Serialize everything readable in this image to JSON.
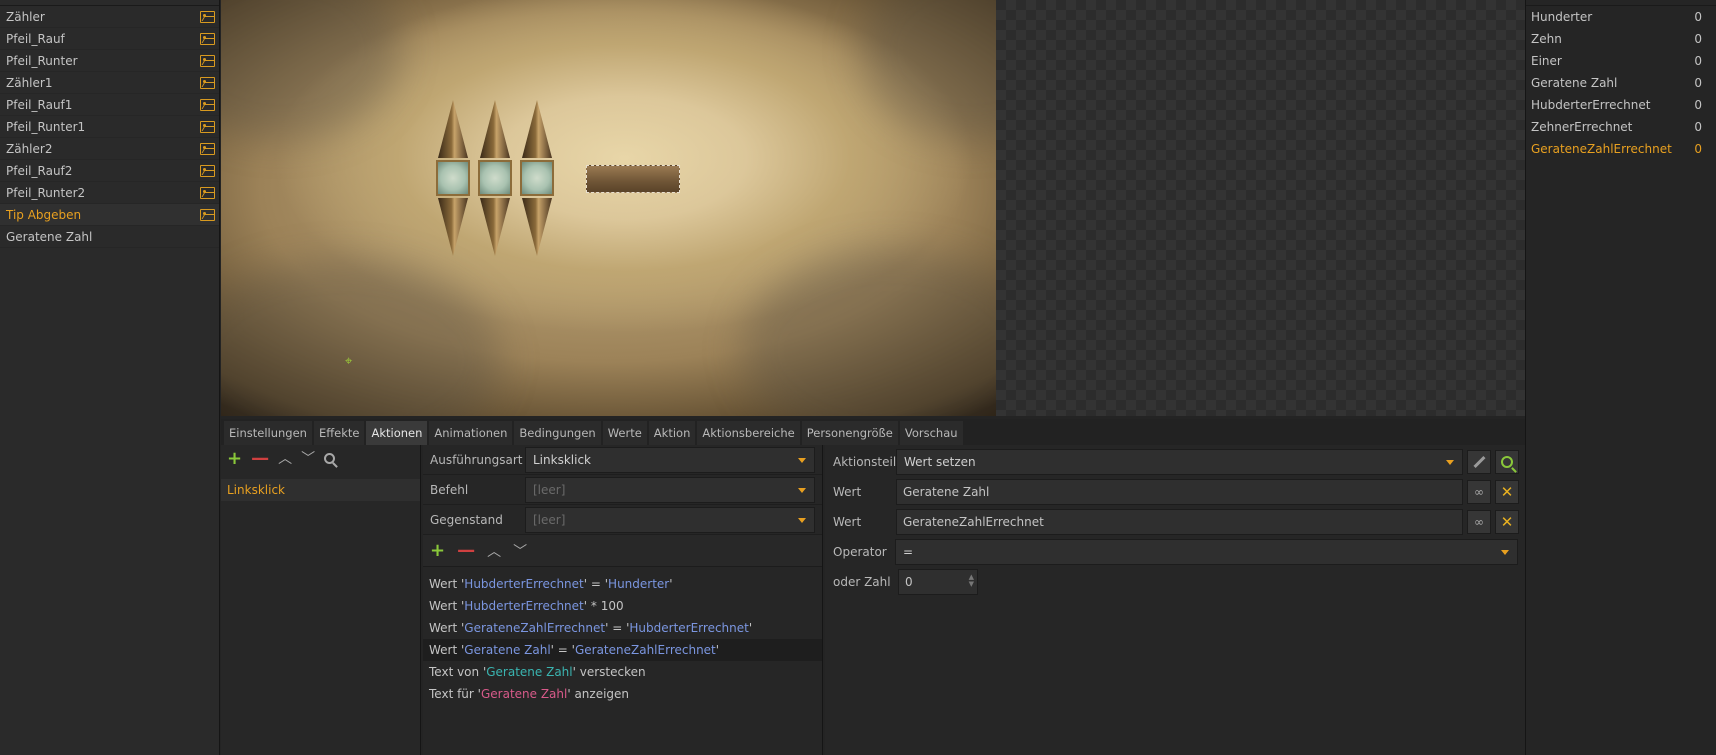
{
  "objects": [
    {
      "label": "Zähler",
      "has_image": true
    },
    {
      "label": "Pfeil_Rauf",
      "has_image": true
    },
    {
      "label": "Pfeil_Runter",
      "has_image": true
    },
    {
      "label": "Zähler1",
      "has_image": true
    },
    {
      "label": "Pfeil_Rauf1",
      "has_image": true
    },
    {
      "label": "Pfeil_Runter1",
      "has_image": true
    },
    {
      "label": "Zähler2",
      "has_image": true
    },
    {
      "label": "Pfeil_Rauf2",
      "has_image": true
    },
    {
      "label": "Pfeil_Runter2",
      "has_image": true
    },
    {
      "label": "Tip Abgeben",
      "has_image": true,
      "selected": true
    },
    {
      "label": "Geratene Zahl",
      "has_image": false
    }
  ],
  "variables": [
    {
      "name": "Hunderter",
      "value": "0"
    },
    {
      "name": "Zehn",
      "value": "0"
    },
    {
      "name": "Einer",
      "value": "0"
    },
    {
      "name": "Geratene Zahl",
      "value": "0"
    },
    {
      "name": "HubderterErrechnet",
      "value": "0"
    },
    {
      "name": "ZehnerErrechnet",
      "value": "0"
    },
    {
      "name": "GerateneZahlErrechnet",
      "value": "0",
      "highlight": true
    }
  ],
  "tabs": [
    "Einstellungen",
    "Effekte",
    "Aktionen",
    "Animationen",
    "Bedingungen",
    "Werte",
    "Aktion",
    "Aktionsbereiche",
    "Personengröße",
    "Vorschau"
  ],
  "active_tab": "Aktionen",
  "triggers": [
    "Linksklick"
  ],
  "form": {
    "exec_label": "Ausführungsart",
    "exec_value": "Linksklick",
    "cmd_label": "Befehl",
    "cmd_value": "[leer]",
    "item_label": "Gegenstand",
    "item_value": "[leer]"
  },
  "actions": [
    {
      "parts": [
        {
          "t": "Wert '",
          "c": ""
        },
        {
          "t": "HubderterErrechnet",
          "c": "blue"
        },
        {
          "t": "' = '",
          "c": ""
        },
        {
          "t": "Hunderter",
          "c": "blue"
        },
        {
          "t": "'",
          "c": ""
        }
      ]
    },
    {
      "parts": [
        {
          "t": "Wert '",
          "c": ""
        },
        {
          "t": "HubderterErrechnet",
          "c": "blue"
        },
        {
          "t": "' * 100",
          "c": ""
        }
      ]
    },
    {
      "parts": [
        {
          "t": "Wert '",
          "c": ""
        },
        {
          "t": "GerateneZahlErrechnet",
          "c": "blue"
        },
        {
          "t": "' = '",
          "c": ""
        },
        {
          "t": "HubderterErrechnet",
          "c": "blue"
        },
        {
          "t": "'",
          "c": ""
        }
      ]
    },
    {
      "parts": [
        {
          "t": "Wert '",
          "c": ""
        },
        {
          "t": "Geratene Zahl",
          "c": "blue"
        },
        {
          "t": "' = '",
          "c": ""
        },
        {
          "t": "GerateneZahlErrechnet",
          "c": "blue"
        },
        {
          "t": "'",
          "c": ""
        }
      ],
      "selected": true
    },
    {
      "parts": [
        {
          "t": "Text von '",
          "c": ""
        },
        {
          "t": "Geratene Zahl",
          "c": "teal"
        },
        {
          "t": "' verstecken",
          "c": ""
        }
      ]
    },
    {
      "parts": [
        {
          "t": "Text für '",
          "c": ""
        },
        {
          "t": "Geratene Zahl",
          "c": "pink"
        },
        {
          "t": "' anzeigen",
          "c": ""
        }
      ]
    }
  ],
  "detail": {
    "part_label": "Aktionsteil",
    "part_value": "Wert setzen",
    "value1_label": "Wert",
    "value1": "Geratene Zahl",
    "value2_label": "Wert",
    "value2": "GerateneZahlErrechnet",
    "operator_label": "Operator",
    "operator_value": "=",
    "number_label": "oder Zahl",
    "number_value": "0"
  },
  "colors": {
    "accent": "#e8a020",
    "add": "#8ac83a",
    "remove": "#d04040",
    "token_blue": "#7b96e0",
    "token_teal": "#3ab4b0",
    "token_pink": "#d85a8a"
  }
}
